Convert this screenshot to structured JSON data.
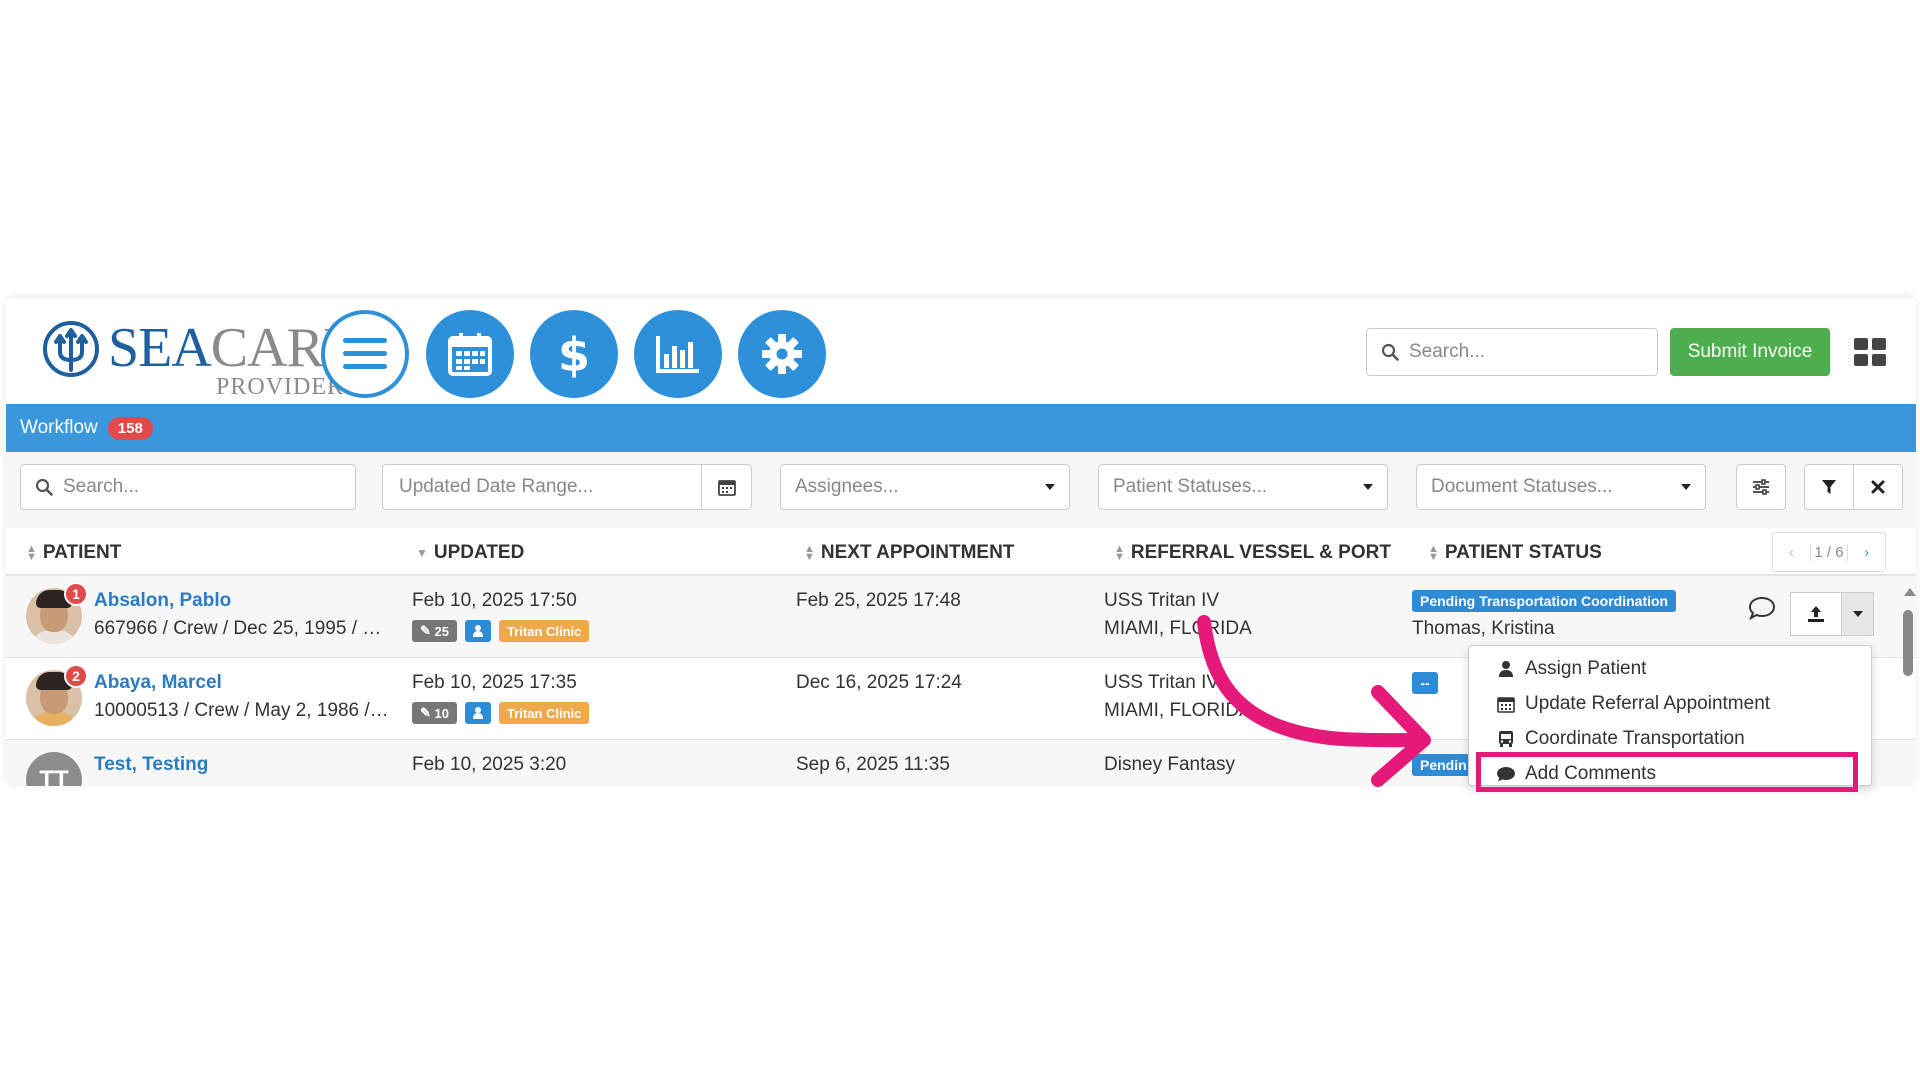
{
  "header": {
    "logo": {
      "brand_part1": "SEA",
      "brand_part2": "CARE",
      "sub": "PROVIDER"
    },
    "nav": [
      {
        "name": "menu-icon"
      },
      {
        "name": "calendar-icon"
      },
      {
        "name": "dollar-icon"
      },
      {
        "name": "bar-chart-icon"
      },
      {
        "name": "gear-icon"
      }
    ],
    "search_placeholder": "Search...",
    "submit_label": "Submit Invoice"
  },
  "workflow": {
    "label": "Workflow",
    "count": "158"
  },
  "filters": {
    "search_placeholder": "Search...",
    "date_placeholder": "Updated Date Range...",
    "assignees_placeholder": "Assignees...",
    "patient_statuses_placeholder": "Patient Statuses...",
    "document_statuses_placeholder": "Document Statuses..."
  },
  "table": {
    "columns": [
      "PATIENT",
      "UPDATED",
      "NEXT APPOINTMENT",
      "REFERRAL VESSEL & PORT",
      "PATIENT STATUS"
    ],
    "pager": {
      "prev": "‹",
      "page": "1 / 6",
      "next": "›"
    },
    "rows": [
      {
        "badge": "1",
        "name": "Absalon, Pablo",
        "meta": "667966 / Crew / Dec 25, 1995 / …",
        "updated": "Feb 10, 2025 17:50",
        "tag_count": "25",
        "tag_clinic": "Tritan Clinic",
        "next_appointment": "Feb 25, 2025 17:48",
        "vessel": "USS Tritan IV",
        "port": "MIAMI, FLORIDA",
        "status": "Pending Transportation Coordination",
        "assignee": "Thomas, Kristina"
      },
      {
        "badge": "2",
        "name": "Abaya, Marcel",
        "meta": "10000513 / Crew / May 2, 1986 /…",
        "updated": "Feb 10, 2025 17:35",
        "tag_count": "10",
        "tag_clinic": "Tritan Clinic",
        "next_appointment": "Dec 16, 2025 17:24",
        "vessel": "USS Tritan IV",
        "port": "MIAMI, FLORIDA",
        "status": "--"
      },
      {
        "initials": "TT",
        "name": "Test, Testing",
        "updated": "Feb 10, 2025 3:20",
        "next_appointment": "Sep 6, 2025 11:35",
        "vessel": "Disney Fantasy",
        "status": "Pendin"
      }
    ]
  },
  "dropdown": {
    "items": [
      {
        "label": "Assign Patient",
        "icon": "user-icon"
      },
      {
        "label": "Update Referral Appointment",
        "icon": "calendar-icon"
      },
      {
        "label": "Coordinate Transportation",
        "icon": "bus-icon"
      },
      {
        "label": "Add Comments",
        "icon": "comment-icon"
      }
    ]
  },
  "colors": {
    "primary": "#3a97dc",
    "nav_button": "#2e90d9",
    "success": "#4cae4c",
    "danger": "#e24a4a",
    "link": "#2a7bc0",
    "clinic_tag": "#f0a94a",
    "annotation": "#e5197a"
  }
}
